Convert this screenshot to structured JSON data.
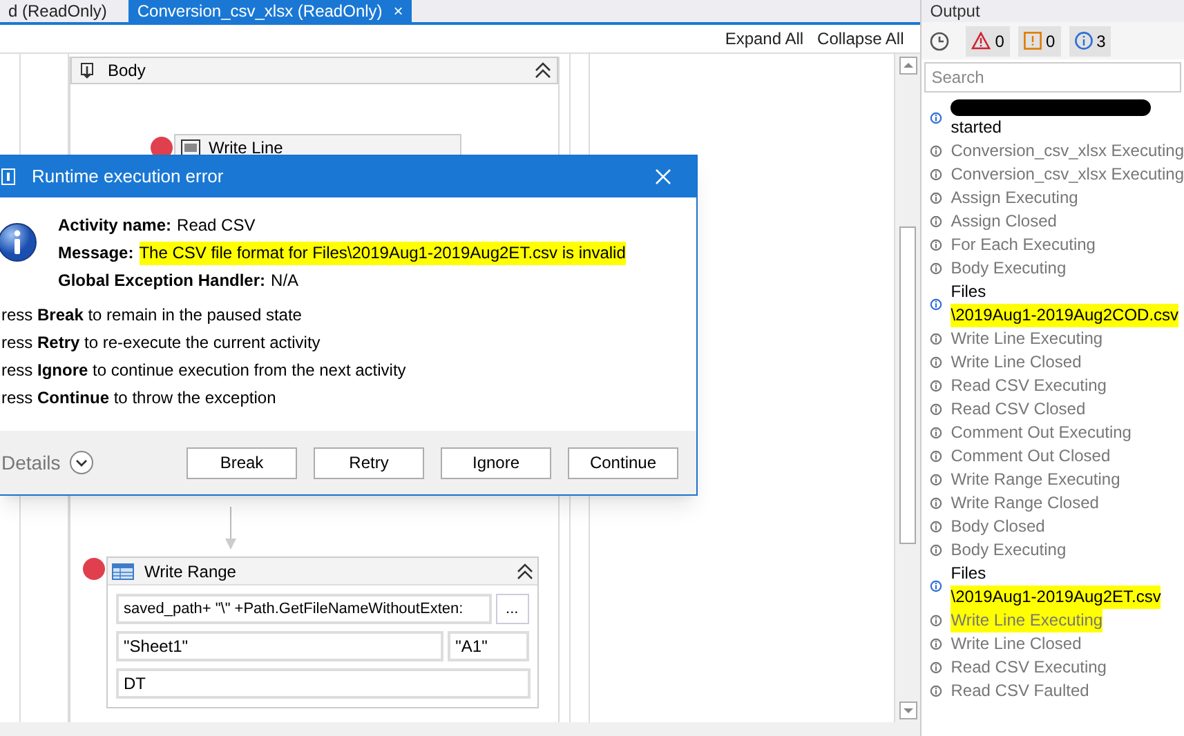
{
  "tabs": [
    {
      "label": "d (ReadOnly)",
      "selected": false
    },
    {
      "label": "Conversion_csv_xlsx (ReadOnly)",
      "selected": true,
      "close": "×"
    }
  ],
  "toolbar": [
    "Expand All",
    "Collapse All"
  ],
  "body": {
    "title": "Body",
    "activities": [
      {
        "title": "Write Line",
        "breakpoint": true
      }
    ]
  },
  "write_range": {
    "title": "Write Range",
    "breakpoint": true,
    "path": "saved_path+ \"\\\" +Path.GetFileNameWithoutExten:",
    "browse": "...",
    "sheet": "\"Sheet1\"",
    "cell": "\"A1\"",
    "table": "DT"
  },
  "dialog": {
    "title": "Runtime execution error",
    "fields": [
      {
        "label": "Activity name:",
        "value": "Read CSV",
        "highlighted": false
      },
      {
        "label": "Message:",
        "value": "The CSV file format for Files\\2019Aug1-2019Aug2ET.csv is invalid",
        "highlighted": true
      },
      {
        "label": "Global Exception Handler:",
        "value": "N/A",
        "highlighted": false
      }
    ],
    "instructions": [
      "ress **Break** to remain in the paused state",
      "ress **Retry** to re-execute the current activity",
      "ress **Ignore** to continue execution from the next activity",
      "ress **Continue** to throw the exception"
    ],
    "details": "Details",
    "buttons": [
      "Break",
      "Retry",
      "Ignore",
      "Continue"
    ]
  },
  "output": {
    "title": "Output",
    "errors": "0",
    "warnings": "0",
    "infos": "3",
    "search": {
      "placeholder": "Search"
    },
    "entries": [
      {
        "kind": "info",
        "lines": [
          "started"
        ],
        "redacted": true,
        "highlighted": false
      },
      {
        "kind": "trace",
        "lines": [
          "Conversion_csv_xlsx Executing"
        ],
        "redacted": false,
        "highlighted": false
      },
      {
        "kind": "trace",
        "lines": [
          "Conversion_csv_xlsx Executing"
        ],
        "redacted": false,
        "highlighted": false
      },
      {
        "kind": "trace",
        "lines": [
          "Assign Executing"
        ],
        "redacted": false,
        "highlighted": false
      },
      {
        "kind": "trace",
        "lines": [
          "Assign Closed"
        ],
        "redacted": false,
        "highlighted": false
      },
      {
        "kind": "trace",
        "lines": [
          "For Each Executing"
        ],
        "redacted": false,
        "highlighted": false
      },
      {
        "kind": "trace",
        "lines": [
          "Body Executing"
        ],
        "redacted": false,
        "highlighted": false
      },
      {
        "kind": "info",
        "lines": [
          "Files",
          "\\2019Aug1-2019Aug2COD.csv"
        ],
        "highlighted": true
      },
      {
        "kind": "trace",
        "lines": [
          "Write Line Executing"
        ],
        "redacted": false,
        "highlighted": false
      },
      {
        "kind": "trace",
        "lines": [
          "Write Line Closed"
        ],
        "redacted": false,
        "highlighted": false
      },
      {
        "kind": "trace",
        "lines": [
          "Read CSV Executing"
        ],
        "redacted": false,
        "highlighted": false
      },
      {
        "kind": "trace",
        "lines": [
          "Read CSV Closed"
        ],
        "redacted": false,
        "highlighted": false
      },
      {
        "kind": "trace",
        "lines": [
          "Comment Out Executing"
        ],
        "redacted": false,
        "highlighted": false
      },
      {
        "kind": "trace",
        "lines": [
          "Comment Out Closed"
        ],
        "redacted": false,
        "highlighted": false
      },
      {
        "kind": "trace",
        "lines": [
          "Write Range Executing"
        ],
        "redacted": false,
        "highlighted": false
      },
      {
        "kind": "trace",
        "lines": [
          "Write Range Closed"
        ],
        "redacted": false,
        "highlighted": false
      },
      {
        "kind": "trace",
        "lines": [
          "Body Closed"
        ],
        "redacted": false,
        "highlighted": false
      },
      {
        "kind": "trace",
        "lines": [
          "Body Executing"
        ],
        "redacted": false,
        "highlighted": false
      },
      {
        "kind": "info",
        "lines": [
          "Files",
          "\\2019Aug1-2019Aug2ET.csv"
        ],
        "highlighted": true
      },
      {
        "kind": "trace",
        "lines": [
          "Write Line Executing"
        ],
        "redacted": false,
        "highlighted": true
      },
      {
        "kind": "trace",
        "lines": [
          "Write Line Closed"
        ],
        "redacted": false,
        "highlighted": false
      },
      {
        "kind": "trace",
        "lines": [
          "Read CSV Executing"
        ],
        "redacted": false,
        "highlighted": false
      },
      {
        "kind": "trace",
        "lines": [
          "Read CSV Faulted"
        ],
        "redacted": false,
        "highlighted": false
      }
    ]
  }
}
